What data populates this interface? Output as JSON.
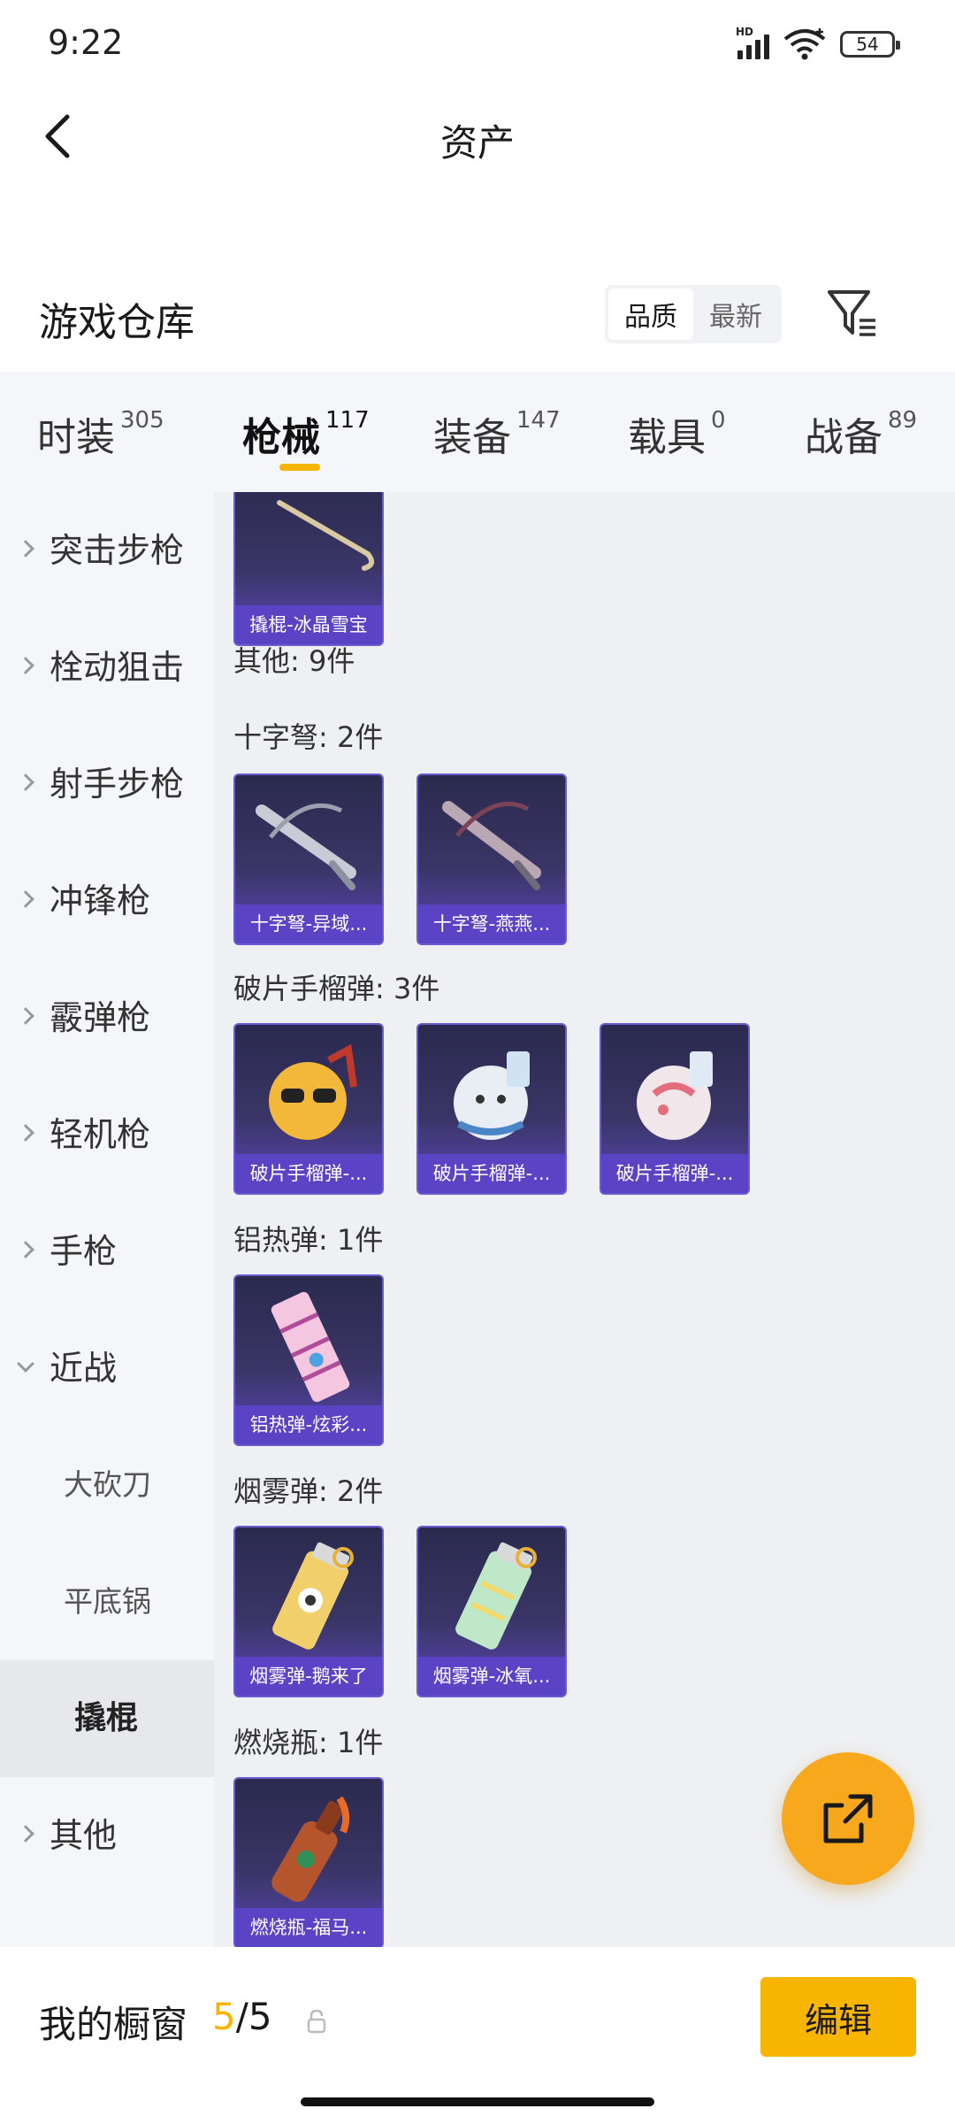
{
  "status": {
    "time": "9:22",
    "network": "HD",
    "battery": "54"
  },
  "nav": {
    "title": "资产"
  },
  "warehouse": {
    "title": "游戏仓库",
    "sort_options": [
      "品质",
      "最新"
    ],
    "active_sort": "品质"
  },
  "tabs": [
    {
      "label": "时装",
      "count": "305"
    },
    {
      "label": "枪械",
      "count": "117",
      "active": true
    },
    {
      "label": "装备",
      "count": "147"
    },
    {
      "label": "载具",
      "count": "0"
    },
    {
      "label": "战备",
      "count": "89"
    }
  ],
  "sidebar": {
    "items": [
      {
        "label": "突击步枪"
      },
      {
        "label": "栓动狙击"
      },
      {
        "label": "射手步枪"
      },
      {
        "label": "冲锋枪"
      },
      {
        "label": "霰弹枪"
      },
      {
        "label": "轻机枪"
      },
      {
        "label": "手枪"
      },
      {
        "label": "近战",
        "expanded": true
      },
      {
        "label": "大砍刀"
      },
      {
        "label": "平底锅"
      },
      {
        "label": "撬棍",
        "selected": true
      },
      {
        "label": "其他"
      }
    ]
  },
  "content": {
    "top_item": "撬棍-冰晶雪宝",
    "groups": [
      {
        "label": "其他: 9件"
      },
      {
        "label": "十字弩: 2件",
        "items": [
          "十字弩-异域...",
          "十字弩-燕燕..."
        ]
      },
      {
        "label": "破片手榴弹: 3件",
        "items": [
          "破片手榴弹-...",
          "破片手榴弹-...",
          "破片手榴弹-..."
        ]
      },
      {
        "label": "铝热弹: 1件",
        "items": [
          "铝热弹-炫彩..."
        ]
      },
      {
        "label": "烟雾弹: 2件",
        "items": [
          "烟雾弹-鹅来了",
          "烟雾弹-冰氧..."
        ]
      },
      {
        "label": "燃烧瓶: 1件",
        "items": [
          "燃烧瓶-福马..."
        ]
      }
    ]
  },
  "bottom": {
    "showcase_label": "我的橱窗",
    "current": "5",
    "separator": "/",
    "max": "5",
    "edit_label": "编辑"
  },
  "icons": [
    "back-icon",
    "filter-icon",
    "share-icon",
    "lock-icon",
    "chevron-right-icon",
    "chevron-down-icon"
  ],
  "colors": {
    "accent": "#f7b500",
    "fab": "#f7a81c",
    "item_caption": "#5a43c4"
  }
}
